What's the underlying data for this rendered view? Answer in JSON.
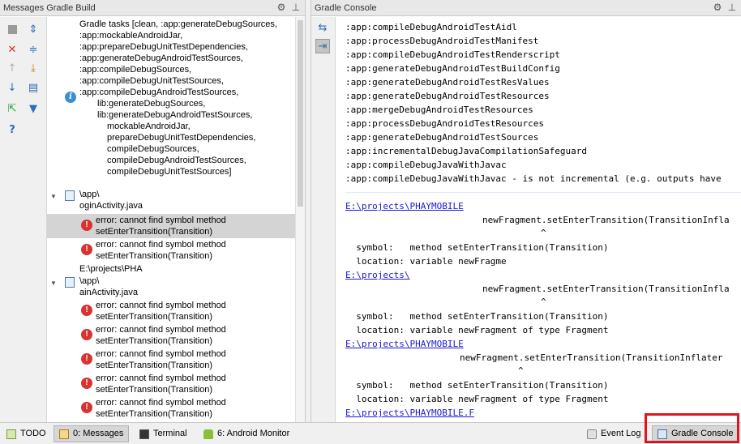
{
  "left_panel": {
    "title": "Messages Gradle Build",
    "tree": {
      "task_lines": [
        "Gradle tasks [clean, :app:generateDebugSources,",
        ":app:mockableAndroidJar,",
        ":app:prepareDebugUnitTestDependencies,",
        ":app:generateDebugAndroidTestSources,",
        ":app:compileDebugSources,",
        ":app:compileDebugUnitTestSources,",
        ":app:compileDebugAndroidTestSources,",
        "lib:generateDebugSources,",
        "lib:generateDebugAndroidTestSources,",
        "mockableAndroidJar,",
        "prepareDebugUnitTestDependencies,",
        "compileDebugSources,",
        "compileDebugAndroidTestSources,",
        "compileDebugUnitTestSources]"
      ],
      "files": [
        {
          "path": "\\app\\",
          "name": "oginActivity.java",
          "errors": [
            {
              "l1": "error: cannot find symbol method",
              "l2": "setEnterTransition(Transition)"
            },
            {
              "l1": "error: cannot find symbol method",
              "l2": "setEnterTransition(Transition)"
            }
          ]
        },
        {
          "path": "\\app\\",
          "name": "ainActivity.java",
          "errors": [
            {
              "l1": "error: cannot find symbol method",
              "l2": "setEnterTransition(Transition)"
            },
            {
              "l1": "error: cannot find symbol method",
              "l2": "setEnterTransition(Transition)"
            },
            {
              "l1": "error: cannot find symbol method",
              "l2": "setEnterTransition(Transition)"
            },
            {
              "l1": "error: cannot find symbol method",
              "l2": "setEnterTransition(Transition)"
            },
            {
              "l1": "error: cannot find symbol method",
              "l2": "setEnterTransition(Transition)"
            }
          ]
        }
      ],
      "path_line": "E:\\projects\\PHA"
    }
  },
  "right_panel": {
    "title": "Gradle Console",
    "console_lines": [
      ":app:compileDebugAndroidTestAidl",
      ":app:processDebugAndroidTestManifest",
      ":app:compileDebugAndroidTestRenderscript",
      ":app:generateDebugAndroidTestBuildConfig",
      ":app:generateDebugAndroidTestResValues",
      ":app:generateDebugAndroidTestResources",
      ":app:mergeDebugAndroidTestResources",
      ":app:processDebugAndroidTestResources",
      ":app:generateDebugAndroidTestSources",
      ":app:incrementalDebugJavaCompilationSafeguard",
      ":app:compileDebugJavaWithJavac",
      ":app:compileDebugJavaWithJavac - is not incremental (e.g. outputs have"
    ],
    "error_blocks": [
      {
        "link": "E:\\projects\\PHAYMOBILE",
        "code": "newFragment.setEnterTransition(TransitionInfla",
        "symbol": "  symbol:   method setEnterTransition(Transition)",
        "location": "  location: variable newFragme"
      },
      {
        "link": "E:\\projects\\",
        "code": "newFragment.setEnterTransition(TransitionInfla",
        "symbol": "  symbol:   method setEnterTransition(Transition)",
        "location": "  location: variable newFragment of type Fragment"
      },
      {
        "link": "E:\\projects\\PHAYMOBILE",
        "code": "newFragment.setEnterTransition(TransitionInflater",
        "symbol": "  symbol:   method setEnterTransition(Transition)",
        "location": "  location: variable newFragment of type Fragment"
      }
    ],
    "last_link": "E:\\projects\\PHAYMOBILE.F"
  },
  "bottom_bar": {
    "todo": "TODO",
    "messages": "0: Messages",
    "terminal": "Terminal",
    "android_monitor": "6: Android Monitor",
    "event_log": "Event Log",
    "gradle_console": "Gradle Console"
  },
  "colors": {
    "error": "#d9322f",
    "info": "#3c8dd6",
    "link": "#1a1ad0",
    "highlight": "#e0141c"
  }
}
